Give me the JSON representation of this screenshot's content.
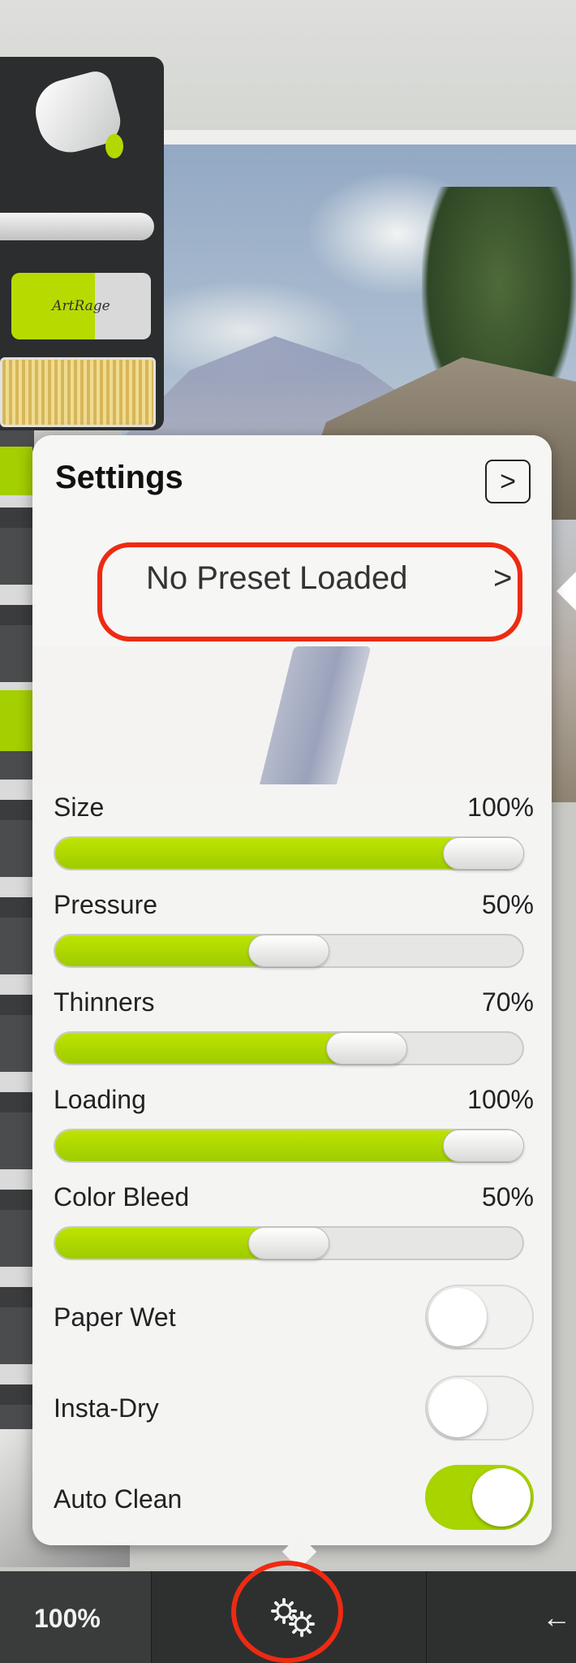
{
  "settings_panel": {
    "title": "Settings",
    "close_button_glyph": ">",
    "preset": {
      "label": "No Preset Loaded",
      "arrow": ">"
    },
    "sliders": [
      {
        "label": "Size",
        "value": "100%",
        "fraction": 1.0
      },
      {
        "label": "Pressure",
        "value": "50%",
        "fraction": 0.5
      },
      {
        "label": "Thinners",
        "value": "70%",
        "fraction": 0.7
      },
      {
        "label": "Loading",
        "value": "100%",
        "fraction": 1.0
      },
      {
        "label": "Color Bleed",
        "value": "50%",
        "fraction": 0.5
      }
    ],
    "toggles": [
      {
        "label": "Paper Wet",
        "on": false
      },
      {
        "label": "Insta-Dry",
        "on": false
      },
      {
        "label": "Auto Clean",
        "on": true
      }
    ]
  },
  "tool_rail": {
    "sticker_logo": "ArtRage"
  },
  "bottom_toolbar": {
    "zoom": "100%",
    "settings_icon": "gears-icon",
    "back_icon": "back-arrow-icon"
  },
  "colors": {
    "accent_green": "#a8d400",
    "highlight_red": "#ee2a12"
  }
}
